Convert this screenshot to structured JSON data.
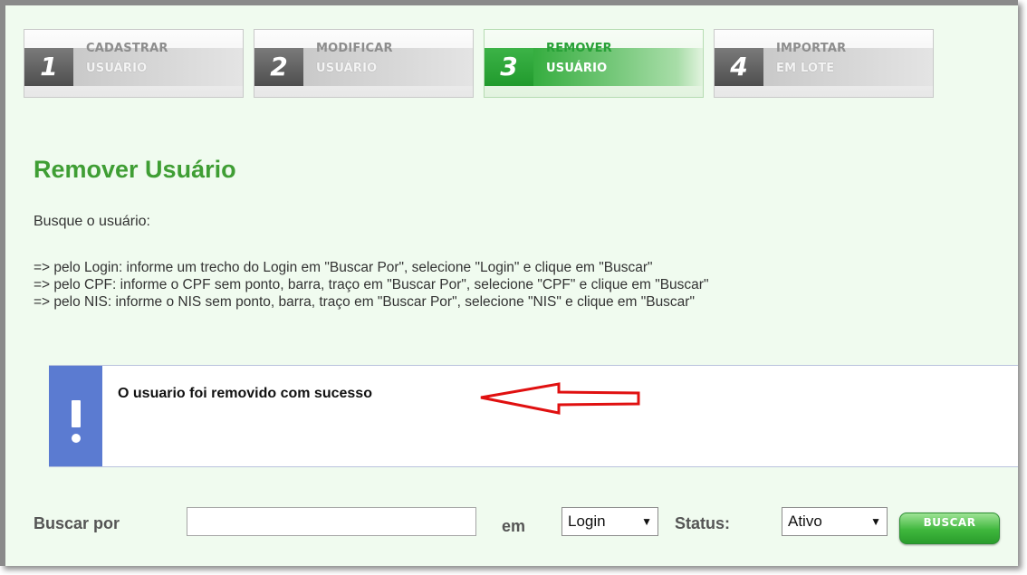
{
  "steps": [
    {
      "number": "1",
      "line1": "CADASTRAR",
      "line2": "USUÁRIO"
    },
    {
      "number": "2",
      "line1": "MODIFICAR",
      "line2": "USUÁRIO"
    },
    {
      "number": "3",
      "line1": "REMOVER",
      "line2": "USUÁRIO",
      "active": true
    },
    {
      "number": "4",
      "line1": "IMPORTAR",
      "line2": "EM LOTE"
    }
  ],
  "page_title": "Remover Usuário",
  "intro": "Busque o usuário:",
  "instructions": [
    "=> pelo Login: informe um trecho do Login em \"Buscar Por\", selecione \"Login\" e clique em \"Buscar\"",
    "=> pelo CPF: informe o CPF sem ponto, barra, traço em \"Buscar Por\", selecione \"CPF\" e clique em \"Buscar\"",
    "=> pelo NIS: informe o NIS sem ponto, barra, traço em \"Buscar Por\", selecione \"NIS\" e clique em \"Buscar\""
  ],
  "notice": {
    "message": "O usuario foi removido com sucesso",
    "icon": "exclamation-icon",
    "color": "#5b7bd1"
  },
  "search": {
    "label": "Buscar por",
    "value": "",
    "in_label": "em",
    "field_select": "Login",
    "status_label": "Status:",
    "status_select": "Ativo",
    "button": "BUSCAR"
  },
  "colors": {
    "accent": "#3f9e34",
    "background": "#f0fbef",
    "annotation_arrow": "#e01010"
  }
}
